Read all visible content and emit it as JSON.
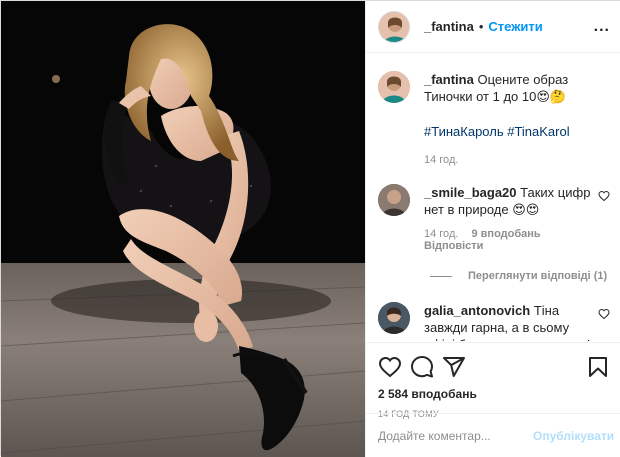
{
  "header": {
    "username": "_fantina",
    "separator": "•",
    "follow_label": "Стежити",
    "more_label": "..."
  },
  "caption": {
    "username": "_fantina",
    "text": "Оцените образ Тиночки от 1 до 10😍🤔",
    "hashtags": "#ТинаКароль #TinaKarol",
    "time": "14 год."
  },
  "comments": [
    {
      "username": "_smile_baga20",
      "text": "Таких цифр нет в природе 😍😍",
      "time": "14 год.",
      "likes": "9 вподобань",
      "reply": "Відповісти",
      "view_replies": "Переглянути відповіді (1)"
    },
    {
      "username": "galia_antonovich",
      "text": "Тіна завжди гарна, а в сьому ефірі була неперевершена! Було гарно все, і сукня, і зачіска, і майкап. Красота!!!👌👌👏😍🌹❤❤❤"
    }
  ],
  "actions": {
    "likes_count": "2 584 вподобань",
    "time_ago": "14 ГОД ТОМУ"
  },
  "add_comment": {
    "placeholder": "Додайте коментар...",
    "post_label": "Опублікувати"
  },
  "colors": {
    "link_blue": "#0095f6",
    "post_disabled": "#b2dffc",
    "muted": "#8e8e8e",
    "text": "#262626"
  }
}
